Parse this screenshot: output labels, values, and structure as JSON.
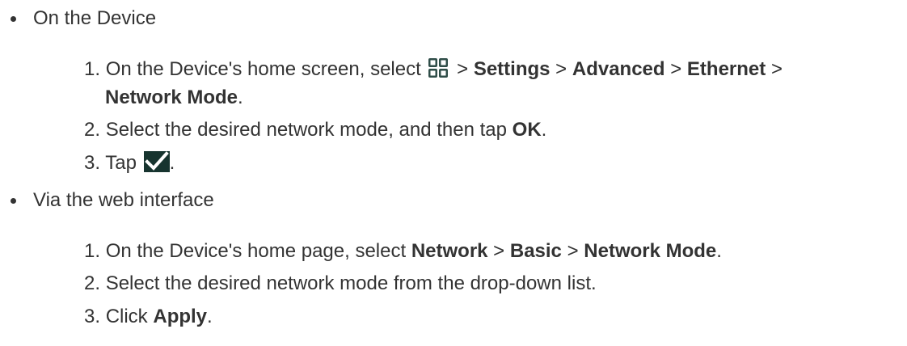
{
  "sections": [
    {
      "bullet_label": "On the Device",
      "steps": [
        {
          "num": "1.",
          "line1": {
            "pre": "On the Device's home screen, select",
            "icon": "apps-grid-icon",
            "sep1": ">",
            "b1": "Settings",
            "sep2": ">",
            "b2": "Advanced",
            "sep3": ">",
            "b3": "Ethernet",
            "sep4": ">"
          },
          "line2": {
            "b4": "Network Mode",
            "end": "."
          }
        },
        {
          "num": "2.",
          "pre": "Select the desired network mode, and then tap",
          "b1": "OK",
          "end": "."
        },
        {
          "num": "3.",
          "pre": "Tap",
          "icon": "checkmark-icon",
          "end": "."
        }
      ]
    },
    {
      "bullet_label": "Via the web interface",
      "steps": [
        {
          "num": "1.",
          "pre": "On the Device's home page, select",
          "b1": "Network",
          "sep1": ">",
          "b2": "Basic",
          "sep2": ">",
          "b3": "Network Mode",
          "end": "."
        },
        {
          "num": "2.",
          "pre": "Select the desired network mode from the drop-down list."
        },
        {
          "num": "3.",
          "pre": "Click",
          "b1": "Apply",
          "end": "."
        }
      ]
    }
  ],
  "colors": {
    "text": "#333333",
    "icon_tile": "#2f4d48",
    "icon_bg": "#ffffff",
    "check_bg": "#17342f",
    "check_mark": "#ffffff"
  }
}
